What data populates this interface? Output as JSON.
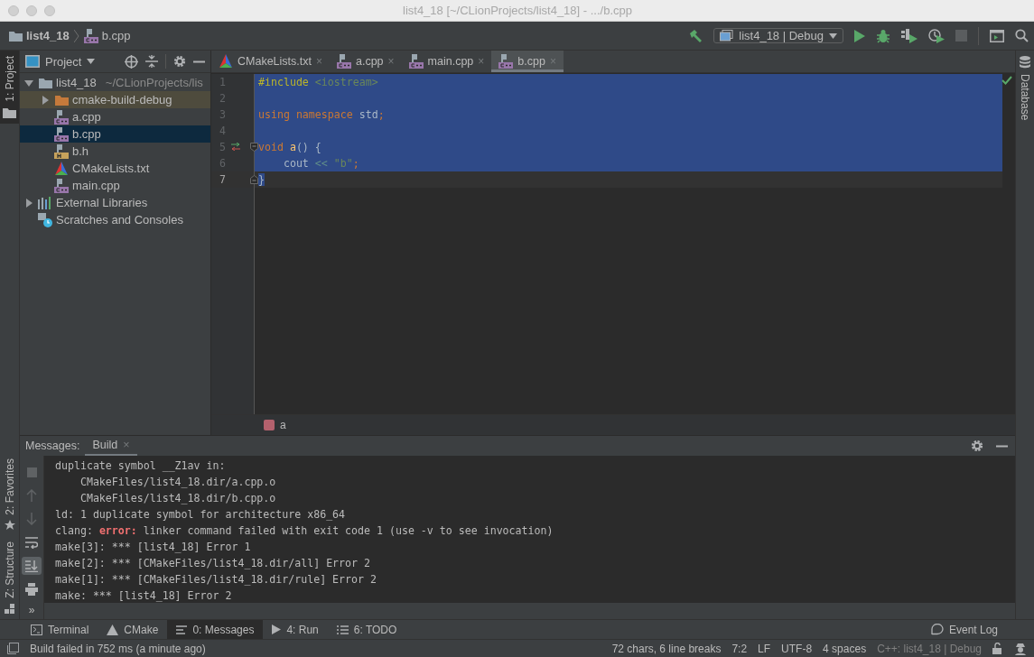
{
  "window": {
    "title": "list4_18 [~/CLionProjects/list4_18] - .../b.cpp"
  },
  "navigation_bar": {
    "breadcrumbs": [
      {
        "label": "list4_18",
        "kind": "folder"
      },
      {
        "label": "b.cpp",
        "kind": "cpp"
      }
    ],
    "run_configuration": "list4_18 | Debug"
  },
  "tool_strips": {
    "left_top": [
      {
        "label": "1: Project",
        "selected": true
      }
    ],
    "left_bottom": [
      {
        "label": "2: Favorites",
        "kind": "star",
        "selected": false
      },
      {
        "label": "Z: Structure",
        "kind": "structure",
        "selected": false
      }
    ],
    "right": [
      {
        "label": "Database",
        "selected": false
      }
    ]
  },
  "project_panel": {
    "title": "Project",
    "tree": [
      {
        "label": "list4_18",
        "path": "~/CLionProjects/lis",
        "kind": "folder",
        "expanded": true,
        "selected": false,
        "children": [
          {
            "label": "cmake-build-debug",
            "kind": "excluded-folder",
            "expanded": false,
            "selected": false
          },
          {
            "label": "a.cpp",
            "kind": "cpp",
            "selected": false
          },
          {
            "label": "b.cpp",
            "kind": "cpp",
            "selected": true
          },
          {
            "label": "b.h",
            "kind": "header",
            "selected": false
          },
          {
            "label": "CMakeLists.txt",
            "kind": "cmake",
            "selected": false
          },
          {
            "label": "main.cpp",
            "kind": "cpp",
            "selected": false
          }
        ]
      },
      {
        "label": "External Libraries",
        "kind": "libraries",
        "expanded": false,
        "selected": false
      },
      {
        "label": "Scratches and Consoles",
        "kind": "scratches",
        "selected": false
      }
    ]
  },
  "editor": {
    "tabs": [
      {
        "label": "CMakeLists.txt",
        "kind": "cmake",
        "selected": false,
        "close": "×"
      },
      {
        "label": "a.cpp",
        "kind": "cpp",
        "selected": false,
        "close": "×"
      },
      {
        "label": "main.cpp",
        "kind": "cpp",
        "selected": false,
        "close": "×"
      },
      {
        "label": "b.cpp",
        "kind": "cpp",
        "selected": true,
        "close": "×"
      }
    ],
    "lines": [
      {
        "number": "1",
        "selected": true,
        "current": false,
        "override_marker": false,
        "fold_start": false,
        "fold_end": false,
        "tokens": [
          {
            "text": "#include",
            "kind": "directive"
          },
          {
            "text": " <iostream>",
            "kind": "string"
          }
        ]
      },
      {
        "number": "2",
        "selected": true,
        "current": false,
        "override_marker": false,
        "fold_start": false,
        "fold_end": false
      },
      {
        "number": "3",
        "selected": true,
        "current": false,
        "override_marker": false,
        "fold_start": false,
        "fold_end": false,
        "tokens": [
          {
            "text": "using namespace",
            "kind": "keyword"
          },
          {
            "text": " std",
            "kind": "plain"
          },
          {
            "text": ";",
            "kind": "keyword"
          }
        ]
      },
      {
        "number": "4",
        "selected": true,
        "current": false,
        "override_marker": false,
        "fold_start": false,
        "fold_end": false
      },
      {
        "number": "5",
        "selected": true,
        "current": false,
        "override_marker": true,
        "fold_start": true,
        "fold_end": false,
        "tokens": [
          {
            "text": "void ",
            "kind": "keyword"
          },
          {
            "text": "a",
            "kind": "function"
          },
          {
            "text": "() {",
            "kind": "plain"
          }
        ]
      },
      {
        "number": "6",
        "selected": true,
        "current": false,
        "override_marker": false,
        "fold_start": false,
        "fold_end": false,
        "tokens": [
          {
            "text": "    cout ",
            "kind": "plain"
          },
          {
            "text": "<<",
            "kind": "operator"
          },
          {
            "text": " \"b\"",
            "kind": "string"
          },
          {
            "text": ";",
            "kind": "keyword"
          }
        ]
      },
      {
        "number": "7",
        "selected": true,
        "current": true,
        "override_marker": false,
        "fold_start": false,
        "fold_end": true,
        "tokens": [
          {
            "text": "}",
            "kind": "plain"
          }
        ]
      }
    ],
    "breadcrumb": "a"
  },
  "messages_panel": {
    "label": "Messages:",
    "tabs": [
      {
        "label": "Build",
        "selected": true,
        "close": "×"
      }
    ],
    "toolbar": [
      {
        "kind": "stop",
        "disabled": true,
        "toggled": false
      },
      {
        "kind": "up",
        "disabled": true,
        "toggled": false
      },
      {
        "kind": "down",
        "disabled": true,
        "toggled": false
      },
      {
        "kind": "wrap",
        "disabled": false,
        "toggled": false
      },
      {
        "kind": "scroll-end",
        "disabled": false,
        "toggled": true
      },
      {
        "kind": "print",
        "disabled": false,
        "toggled": false
      }
    ],
    "more": "»",
    "output": [
      {
        "parts": [
          {
            "text": "duplicate symbol __Z1av in:",
            "kind": "plain"
          }
        ]
      },
      {
        "parts": [
          {
            "text": "    CMakeFiles/list4_18.dir/a.cpp.o",
            "kind": "plain"
          }
        ]
      },
      {
        "parts": [
          {
            "text": "    CMakeFiles/list4_18.dir/b.cpp.o",
            "kind": "plain"
          }
        ]
      },
      {
        "parts": [
          {
            "text": "ld: 1 duplicate symbol for architecture x86_64",
            "kind": "plain"
          }
        ]
      },
      {
        "parts": [
          {
            "text": "clang: ",
            "kind": "plain"
          },
          {
            "text": "error:",
            "kind": "error"
          },
          {
            "text": " linker command failed with exit code 1 (use -v to see invocation)",
            "kind": "plain"
          }
        ]
      },
      {
        "parts": [
          {
            "text": "make[3]: *** [list4_18] Error 1",
            "kind": "plain"
          }
        ]
      },
      {
        "parts": [
          {
            "text": "make[2]: *** [CMakeFiles/list4_18.dir/all] Error 2",
            "kind": "plain"
          }
        ]
      },
      {
        "parts": [
          {
            "text": "make[1]: *** [CMakeFiles/list4_18.dir/rule] Error 2",
            "kind": "plain"
          }
        ]
      },
      {
        "parts": [
          {
            "text": "make: *** [list4_18] Error 2",
            "kind": "plain"
          }
        ]
      }
    ]
  },
  "tool_windows": [
    {
      "label": "Terminal",
      "kind": "terminal",
      "selected": false
    },
    {
      "label": "CMake",
      "kind": "cmake",
      "selected": false
    },
    {
      "label": "0: Messages",
      "kind": "messages",
      "selected": true
    },
    {
      "label": "4: Run",
      "kind": "run",
      "selected": false
    },
    {
      "label": "6: TODO",
      "kind": "todo",
      "selected": false
    }
  ],
  "event_log": "Event Log",
  "status_bar": {
    "message": "Build failed in 752 ms (a minute ago)",
    "items": [
      {
        "text": "72 chars, 6 line breaks",
        "disabled": false
      },
      {
        "text": "7:2",
        "disabled": false
      },
      {
        "text": "LF",
        "disabled": false
      },
      {
        "text": "UTF-8",
        "disabled": false
      },
      {
        "text": "4 spaces",
        "disabled": false
      },
      {
        "text": "C++: list4_18 | Debug",
        "disabled": true
      }
    ]
  }
}
